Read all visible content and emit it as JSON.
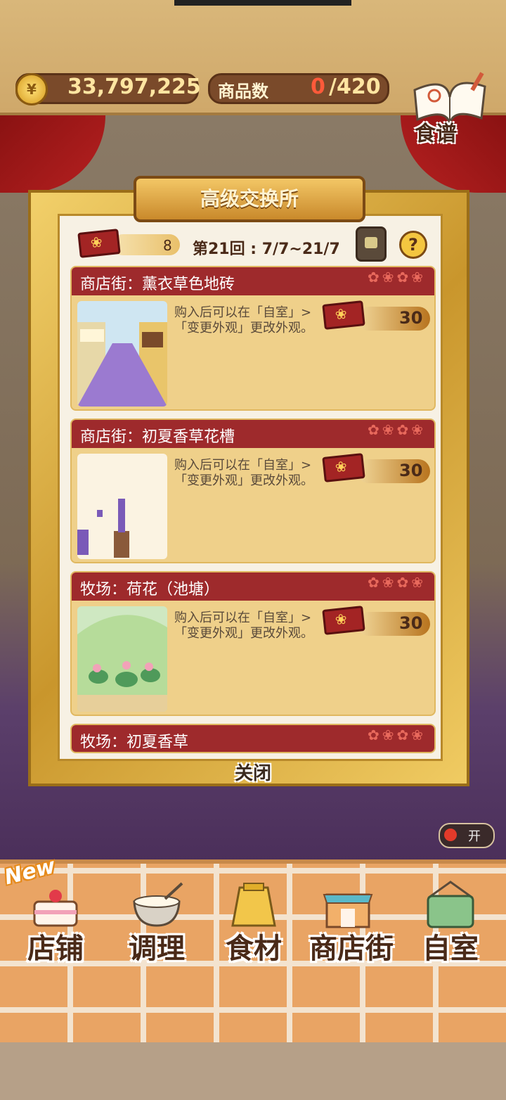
{
  "topbar": {
    "coin_symbol": "¥",
    "money": "33,797,225",
    "goods_label": "商品数",
    "goods_current": "0",
    "goods_max": "/420",
    "recipe_label": "食谱"
  },
  "modal": {
    "title": "高级交换所",
    "ticket_count": "8",
    "round": "第21回 : 7/7~21/7",
    "help": "?",
    "close": "关闭"
  },
  "items": [
    {
      "title": "商店街：薰衣草色地砖",
      "desc": "购入后可以在「自室」>「变更外观」更改外观。",
      "price": "30"
    },
    {
      "title": "商店街：初夏香草花槽",
      "desc": "购入后可以在「自室」>「变更外观」更改外观。",
      "price": "30"
    },
    {
      "title": "牧场：荷花（池塘）",
      "desc": "购入后可以在「自室」>「变更外观」更改外观。",
      "price": "30"
    },
    {
      "title": "牧场：初夏香草",
      "desc": "",
      "price": ""
    }
  ],
  "open_toggle": "开",
  "bottom_nav": {
    "new_badge": "New",
    "items": [
      "店铺",
      "调理",
      "食材",
      "商店街",
      "自室"
    ]
  },
  "colors": {
    "item_header": "#9e2a2c",
    "frame_gold": "#c9962c",
    "ticket_red": "#a32424"
  }
}
